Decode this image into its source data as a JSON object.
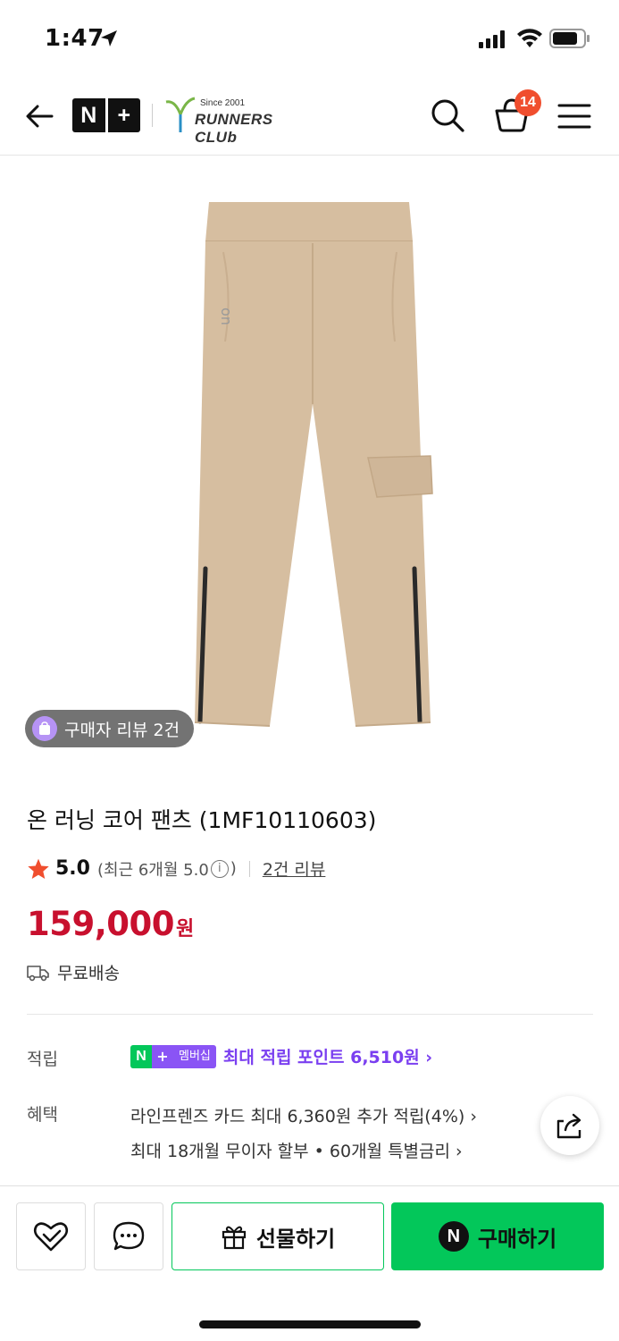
{
  "status_bar": {
    "time": "1:47"
  },
  "header": {
    "naver_plus_logo": [
      "N",
      "+"
    ],
    "brand_logo_since": "Since 2001",
    "brand_logo_name": "RUNNERS CLUb",
    "cart_count": "14"
  },
  "product": {
    "review_chip": "구매자 리뷰 2건",
    "title": "온 러닝 코어 팬츠 (1MF10110603)",
    "rating": "5.0",
    "recent_rating": "(최근 6개월 5.0",
    "recent_rating_close": ")",
    "review_link": "2건 리뷰",
    "price": "159,000",
    "currency": "원",
    "shipping": "무료배송"
  },
  "benefits": {
    "points_label": "적립",
    "membership_badge": {
      "n": "N",
      "plus": "+",
      "text": "멤버십"
    },
    "points_text": "최대 적립 포인트 6,510원 ›",
    "benefit_label": "혜택",
    "benefit_line1": "라인프렌즈 카드 최대 6,360원 추가 적립(4%) ›",
    "benefit_line2": "최대 18개월 무이자 할부 • 60개월 특별금리 ›"
  },
  "bottom_bar": {
    "gift_label": "선물하기",
    "buy_icon_letter": "N",
    "buy_label": "구매하기"
  },
  "colors": {
    "price_red": "#c8102e",
    "naver_green": "#03c75a",
    "membership_purple": "#8a54f5",
    "cart_badge": "#f04e2e",
    "pants_beige": "#d6bea0"
  }
}
